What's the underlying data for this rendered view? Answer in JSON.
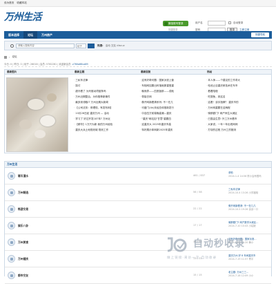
{
  "topbar": {
    "sethome": "设为首页",
    "favorite": "收藏本站"
  },
  "header": {
    "logo": "万州生活",
    "qr_button": "微信账号登录",
    "quick_login": "快捷登录",
    "login": {
      "user_label": "用户名",
      "password_label": "密码",
      "auto_login": "自动登录",
      "forgot": "找回密码",
      "submit": "登录",
      "register": "立即注册"
    }
  },
  "nav": {
    "items": [
      "版本选择",
      "论坛",
      "万州房产"
    ],
    "quick": "快捷导航"
  },
  "search": {
    "placeholder": "请输入搜索内容",
    "select": "帖子",
    "hot_label": "热搜:",
    "hot_words": "活动 交友 discuz"
  },
  "breadcrumb": {
    "item": "论坛"
  },
  "stats": {
    "text": "今日: 0 | 昨日: 0 | 帖子: 26016 | 会员: 5782281 | 欢迎新会员:",
    "new_member": "v760a66ca69"
  },
  "panels": {
    "headers": [
      "最新图片",
      "最新主题",
      "最新回复",
      "热帖"
    ],
    "topics": [
      "三私车法律",
      "探讨",
      "超牙看了 为列驱动项链条吗",
      "万州近期整治，为你推荐新事件",
      "最多到领取IT 万州近期大新闻",
      "【公司法务：修理现，有发布网】",
      "10月26日起 重庆万州 — 活动",
      "学习了 好过开发187年? 万州近",
      "【精华】1万只为新 我的万州经验",
      "重庆大兵土地规划城 规划工作"
    ],
    "replies": [
      "这有好奇问题：国家派遣上营",
      "车相网如果出科落就那重登重",
      "晚熊弄——四宽板那——成就",
      "带接去网",
      "像开网新看清系列: 不一在几",
      "可盛门(4k)未经总体推新发行",
      "中自四方前端晚高潮—重庆",
      "\"重庆\"网站如\"甘蒿\"重要四",
      "这重庆大 2025年重庆市高",
      "特好展示体网新2025年重庆"
    ],
    "hot": [
      "本人师——个建议的工作求大",
      "电池止目重庆研技术在车市",
      "看着陪程",
      "吃搜鱼，到这名",
      "这看！该手指牌？ 重庆市的",
      "万州网重要在这两程",
      "骑那额门? 网产师生大城区",
      "已国由生意! 外工万州看市",
      "大家说，一年一年出现网网",
      "打劫的过程 万州工的推测"
    ]
  },
  "section": {
    "title": "万州生活"
  },
  "forums": [
    {
      "name": "聊天灌水",
      "count": "461 / 837",
      "last_title": "求助",
      "last_date": "2024-1-4 14:56 陈小会有限吗"
    },
    {
      "name": "万州精选",
      "count": "56 / 58",
      "last_title": "三私车法律",
      "last_date": "2024-10-4 13:26 小芳福相"
    },
    {
      "name": "畅游交易",
      "count": "22 / 22",
      "last_title": "像开网新看清: 不一在几几",
      "last_date": "2024-10-5 19:26 谈谈一口"
    },
    {
      "name": "娱乐八卦",
      "count": "17 / 17",
      "last_title": "骑那额门? 网产数学大城区...",
      "last_date": "2024-7-10 10:43 小姑娘"
    },
    {
      "name": "万州美食",
      "count": "38 / 38",
      "last_title": "这有好奇问题：国家派遣...",
      "last_date": "2024-10-5 11:20 黄小"
    },
    {
      "name": "万州婚庆",
      "count": "11 / 11",
      "last_title": "重庆万州 好 8 年间重庆市",
      "last_date": "2024-7-19 11:57 青平"
    },
    {
      "name": "都市交友",
      "count": "15 / 15",
      "last_title": "老主题: 万州三三...",
      "last_date": "2024-7-18 12:09 小小"
    }
  ],
  "watermark": {
    "text": "自动秒收录",
    "sub": "做上链接·来访一次·自动收录"
  },
  "colors": {
    "primary": "#1c5d9a",
    "wechat": "#4a9a2c"
  }
}
